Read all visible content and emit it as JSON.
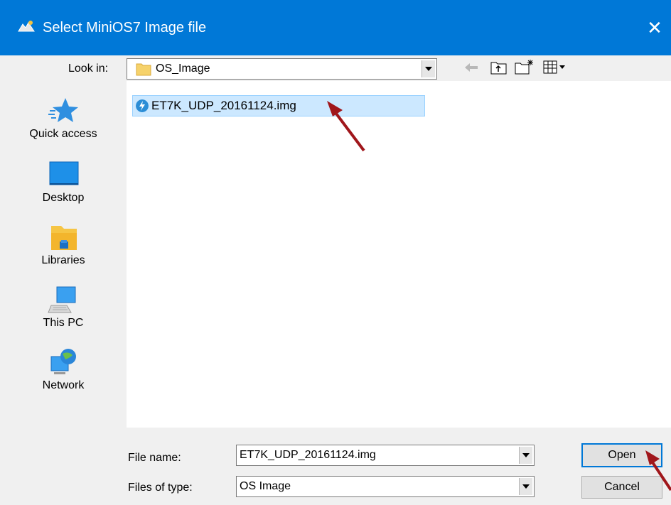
{
  "window": {
    "title": "Select MiniOS7 Image file",
    "close_glyph": "✕"
  },
  "toolbar": {
    "look_in_label": "Look in:",
    "look_in_value": "OS_Image",
    "icons": [
      "back-arrow-icon",
      "up-folder-icon",
      "new-folder-icon",
      "view-menu-icon"
    ]
  },
  "sidebar": {
    "items": [
      {
        "label": "Quick access",
        "icon": "star-icon"
      },
      {
        "label": "Desktop",
        "icon": "desktop-icon"
      },
      {
        "label": "Libraries",
        "icon": "libraries-icon"
      },
      {
        "label": "This PC",
        "icon": "computer-icon"
      },
      {
        "label": "Network",
        "icon": "network-icon"
      }
    ]
  },
  "files": [
    {
      "name": "ET7K_UDP_20161124.img",
      "selected": true,
      "icon": "file-lightning-icon"
    }
  ],
  "footer": {
    "file_name_label": "File name:",
    "file_name_value": "ET7K_UDP_20161124.img",
    "file_type_label": "Files of type:",
    "file_type_value": "OS Image",
    "open_label": "Open",
    "cancel_label": "Cancel"
  },
  "colors": {
    "titlebar": "#0078d7",
    "selection": "#cce8ff",
    "annotation_arrow": "#a0161b"
  }
}
